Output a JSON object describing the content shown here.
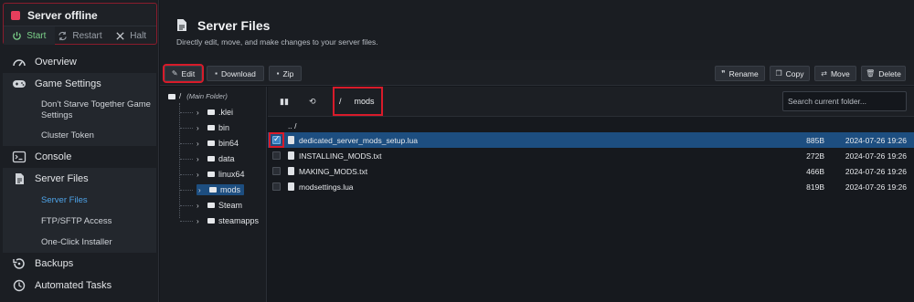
{
  "server": {
    "status": "Server offline",
    "actions": {
      "start": "Start",
      "restart": "Restart",
      "halt": "Halt"
    }
  },
  "nav": {
    "overview": "Overview",
    "game_settings": "Game Settings",
    "game_settings_items": [
      "Don't Starve Together Game Settings",
      "Cluster Token"
    ],
    "console": "Console",
    "server_files": "Server Files",
    "server_files_items": [
      "Server Files",
      "FTP/SFTP Access",
      "One-Click Installer"
    ],
    "backups": "Backups",
    "automated_tasks": "Automated Tasks"
  },
  "page": {
    "title": "Server Files",
    "subtitle": "Directly edit, move, and make changes to your server files."
  },
  "toolbar": {
    "edit": "Edit",
    "download": "Download",
    "zip": "Zip",
    "rename": "Rename",
    "copy": "Copy",
    "move": "Move",
    "delete": "Delete"
  },
  "tree": {
    "root": "/",
    "root_label": "(Main Folder)",
    "folders": [
      ".klei",
      "bin",
      "bin64",
      "data",
      "linux64",
      "mods",
      "Steam",
      "steamapps"
    ],
    "selected": "mods"
  },
  "path": {
    "root": "/",
    "current": "mods"
  },
  "search": {
    "placeholder": "Search current folder..."
  },
  "files": {
    "up": ".. /",
    "items": [
      {
        "name": "dedicated_server_mods_setup.lua",
        "size": "885B",
        "date": "2024-07-26 19:26",
        "selected": true
      },
      {
        "name": "INSTALLING_MODS.txt",
        "size": "272B",
        "date": "2024-07-26 19:26",
        "selected": false
      },
      {
        "name": "MAKING_MODS.txt",
        "size": "466B",
        "date": "2024-07-26 19:26",
        "selected": false
      },
      {
        "name": "modsettings.lua",
        "size": "819B",
        "date": "2024-07-26 19:26",
        "selected": false
      }
    ]
  },
  "colors": {
    "accent": "#4ea3e8",
    "selection": "#1d4e80",
    "highlight": "#d81b2a",
    "offline": "#e63e5c",
    "start": "#7cd28a"
  }
}
